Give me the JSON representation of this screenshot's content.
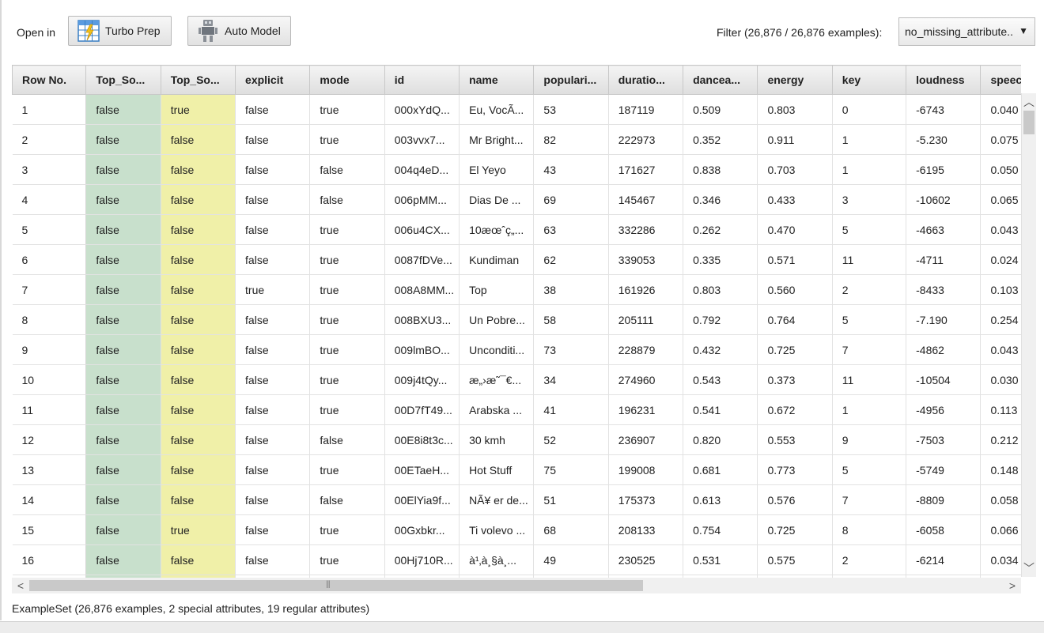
{
  "toolbar": {
    "open_in_label": "Open in",
    "turbo_prep_label": "Turbo Prep",
    "auto_model_label": "Auto Model",
    "filter_label": "Filter (26,876 / 26,876 examples):",
    "filter_value": "no_missing_attribute.."
  },
  "colors": {
    "label_green": "#c8e0cc",
    "label_yellow": "#f0f0a8"
  },
  "icons": {
    "turbo_prep": "turbo-prep-grid-icon",
    "auto_model": "robot-icon"
  },
  "table": {
    "columns": [
      "Row No.",
      "Top_So...",
      "Top_So...",
      "explicit",
      "mode",
      "id",
      "name",
      "populari...",
      "duratio...",
      "dancea...",
      "energy",
      "key",
      "loudness",
      "speecl"
    ],
    "rows": [
      [
        "1",
        "false",
        "true",
        "false",
        "true",
        "000xYdQ...",
        "Eu, VocÃ...",
        "53",
        "187119",
        "0.509",
        "0.803",
        "0",
        "-6743",
        "0.040"
      ],
      [
        "2",
        "false",
        "false",
        "false",
        "true",
        "003vvx7...",
        "Mr Bright...",
        "82",
        "222973",
        "0.352",
        "0.911",
        "1",
        "-5.230",
        "0.075"
      ],
      [
        "3",
        "false",
        "false",
        "false",
        "false",
        "004q4eD...",
        "El Yeyo",
        "43",
        "171627",
        "0.838",
        "0.703",
        "1",
        "-6195",
        "0.050"
      ],
      [
        "4",
        "false",
        "false",
        "false",
        "false",
        "006pMM...",
        "Dias De ...",
        "69",
        "145467",
        "0.346",
        "0.433",
        "3",
        "-10602",
        "0.065"
      ],
      [
        "5",
        "false",
        "false",
        "false",
        "true",
        "006u4CX...",
        "10æœˆç„...",
        "63",
        "332286",
        "0.262",
        "0.470",
        "5",
        "-4663",
        "0.043"
      ],
      [
        "6",
        "false",
        "false",
        "false",
        "true",
        "0087fDVe...",
        "Kundiman",
        "62",
        "339053",
        "0.335",
        "0.571",
        "11",
        "-4711",
        "0.024"
      ],
      [
        "7",
        "false",
        "false",
        "true",
        "true",
        "008A8MM...",
        "Top",
        "38",
        "161926",
        "0.803",
        "0.560",
        "2",
        "-8433",
        "0.103"
      ],
      [
        "8",
        "false",
        "false",
        "false",
        "true",
        "008BXU3...",
        "Un Pobre...",
        "58",
        "205111",
        "0.792",
        "0.764",
        "5",
        "-7.190",
        "0.254"
      ],
      [
        "9",
        "false",
        "false",
        "false",
        "true",
        "009lmBO...",
        "Unconditi...",
        "73",
        "228879",
        "0.432",
        "0.725",
        "7",
        "-4862",
        "0.043"
      ],
      [
        "10",
        "false",
        "false",
        "false",
        "true",
        "009j4tQy...",
        "æ„›æ˜¯€...",
        "34",
        "274960",
        "0.543",
        "0.373",
        "11",
        "-10504",
        "0.030"
      ],
      [
        "11",
        "false",
        "false",
        "false",
        "true",
        "00D7fT49...",
        "Arabska ...",
        "41",
        "196231",
        "0.541",
        "0.672",
        "1",
        "-4956",
        "0.113"
      ],
      [
        "12",
        "false",
        "false",
        "false",
        "false",
        "00E8i8t3c...",
        "30 kmh",
        "52",
        "236907",
        "0.820",
        "0.553",
        "9",
        "-7503",
        "0.212"
      ],
      [
        "13",
        "false",
        "false",
        "false",
        "true",
        "00ETaeH...",
        "Hot Stuff",
        "75",
        "199008",
        "0.681",
        "0.773",
        "5",
        "-5749",
        "0.148"
      ],
      [
        "14",
        "false",
        "false",
        "false",
        "false",
        "00ElYia9f...",
        "NÃ¥ er de...",
        "51",
        "175373",
        "0.613",
        "0.576",
        "7",
        "-8809",
        "0.058"
      ],
      [
        "15",
        "false",
        "true",
        "false",
        "true",
        "00Gxbkr...",
        "Ti volevo ...",
        "68",
        "208133",
        "0.754",
        "0.725",
        "8",
        "-6058",
        "0.066"
      ],
      [
        "16",
        "false",
        "false",
        "false",
        "true",
        "00Hj710R...",
        "à¹‚à¸§à¸...",
        "49",
        "230525",
        "0.531",
        "0.575",
        "2",
        "-6214",
        "0.034"
      ],
      [
        "",
        "",
        "",
        "",
        "",
        "",
        "",
        "",
        "",
        "",
        "",
        "",
        "",
        ""
      ]
    ]
  },
  "status_text": "ExampleSet (26,876 examples, 2 special attributes, 19 regular attributes)"
}
